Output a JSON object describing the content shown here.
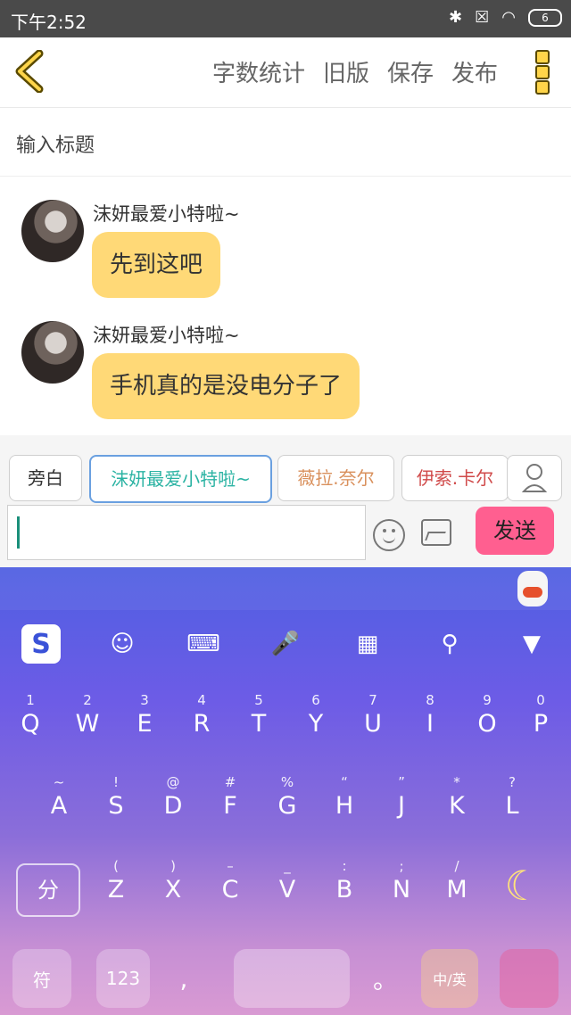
{
  "status_bar": {
    "time": "下午2:52",
    "battery": "6"
  },
  "toolbar": {
    "actions": [
      "字数统计",
      "旧版",
      "保存",
      "发布"
    ]
  },
  "title_placeholder": "输入标题",
  "messages": [
    {
      "name": "沫妍最爱小特啦~",
      "text": "先到这吧"
    },
    {
      "name": "沫妍最爱小特啦~",
      "text": "手机真的是没电分子了"
    }
  ],
  "roles": [
    {
      "label": "旁白",
      "color": "#555555",
      "selected": false
    },
    {
      "label": "沫妍最爱小特啦~",
      "color": "#2bb3a3",
      "selected": true
    },
    {
      "label": "薇拉.奈尔",
      "color": "#d9905c",
      "selected": false
    },
    {
      "label": "伊索.卡尔",
      "color": "#d04a4a",
      "selected": false
    }
  ],
  "composer": {
    "send_label": "发送"
  },
  "keyboard": {
    "row1": [
      {
        "sub": "1",
        "key": "Q"
      },
      {
        "sub": "2",
        "key": "W"
      },
      {
        "sub": "3",
        "key": "E"
      },
      {
        "sub": "4",
        "key": "R"
      },
      {
        "sub": "5",
        "key": "T"
      },
      {
        "sub": "6",
        "key": "Y"
      },
      {
        "sub": "7",
        "key": "U"
      },
      {
        "sub": "8",
        "key": "I"
      },
      {
        "sub": "9",
        "key": "O"
      },
      {
        "sub": "0",
        "key": "P"
      }
    ],
    "row2": [
      {
        "sub": "~",
        "key": "A"
      },
      {
        "sub": "!",
        "key": "S"
      },
      {
        "sub": "@",
        "key": "D"
      },
      {
        "sub": "#",
        "key": "F"
      },
      {
        "sub": "%",
        "key": "G"
      },
      {
        "sub": "“",
        "key": "H"
      },
      {
        "sub": "”",
        "key": "J"
      },
      {
        "sub": "*",
        "key": "K"
      },
      {
        "sub": "?",
        "key": "L"
      }
    ],
    "row3": [
      {
        "sub": "(",
        "key": "Z"
      },
      {
        "sub": ")",
        "key": "X"
      },
      {
        "sub": "–",
        "key": "C"
      },
      {
        "sub": "_",
        "key": "V"
      },
      {
        "sub": ":",
        "key": "B"
      },
      {
        "sub": ";",
        "key": "N"
      },
      {
        "sub": "/",
        "key": "M"
      }
    ],
    "shift_label": "分",
    "symbol_label": "符",
    "num_label": "123",
    "comma_label": ",",
    "period_label": "。",
    "cn_en_label": "中/英"
  },
  "colors": {
    "bubble": "#ffd977",
    "send": "#ff5f90",
    "selected_role_border": "#6aa0e0"
  },
  "icons": [
    "back-chevron-icon",
    "more-icon",
    "emoji-icon",
    "image-icon",
    "person-icon",
    "sogou-icon",
    "emoji-face-icon",
    "keyboard-icon",
    "mic-icon",
    "apps-icon",
    "search-icon",
    "collapse-icon"
  ]
}
